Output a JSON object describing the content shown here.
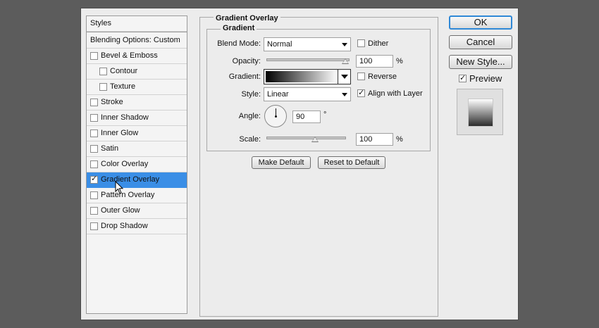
{
  "styles_panel": {
    "header": "Styles",
    "blending_options": "Blending Options: Custom",
    "items": [
      {
        "label": "Bevel & Emboss",
        "checked": false,
        "indent": false
      },
      {
        "label": "Contour",
        "checked": false,
        "indent": true
      },
      {
        "label": "Texture",
        "checked": false,
        "indent": true
      },
      {
        "label": "Stroke",
        "checked": false,
        "indent": false
      },
      {
        "label": "Inner Shadow",
        "checked": false,
        "indent": false
      },
      {
        "label": "Inner Glow",
        "checked": false,
        "indent": false
      },
      {
        "label": "Satin",
        "checked": false,
        "indent": false
      },
      {
        "label": "Color Overlay",
        "checked": false,
        "indent": false
      },
      {
        "label": "Gradient Overlay",
        "checked": true,
        "indent": false,
        "selected": true
      },
      {
        "label": "Pattern Overlay",
        "checked": false,
        "indent": false
      },
      {
        "label": "Outer Glow",
        "checked": false,
        "indent": false
      },
      {
        "label": "Drop Shadow",
        "checked": false,
        "indent": false
      }
    ]
  },
  "gradient_overlay": {
    "title": "Gradient Overlay",
    "subtitle": "Gradient",
    "blend_mode": {
      "label": "Blend Mode:",
      "value": "Normal"
    },
    "dither": {
      "label": "Dither",
      "checked": false
    },
    "opacity": {
      "label": "Opacity:",
      "value": "100",
      "unit": "%"
    },
    "gradient": {
      "label": "Gradient:"
    },
    "reverse": {
      "label": "Reverse",
      "checked": false
    },
    "style": {
      "label": "Style:",
      "value": "Linear"
    },
    "align_with_layer": {
      "label": "Align with Layer",
      "checked": true
    },
    "angle": {
      "label": "Angle:",
      "value": "90",
      "unit": "°"
    },
    "scale": {
      "label": "Scale:",
      "value": "100",
      "unit": "%"
    },
    "make_default": "Make Default",
    "reset_to_default": "Reset to Default"
  },
  "buttons": {
    "ok": "OK",
    "cancel": "Cancel",
    "new_style": "New Style..."
  },
  "preview": {
    "label": "Preview",
    "checked": true
  },
  "check_glyph": "✓"
}
